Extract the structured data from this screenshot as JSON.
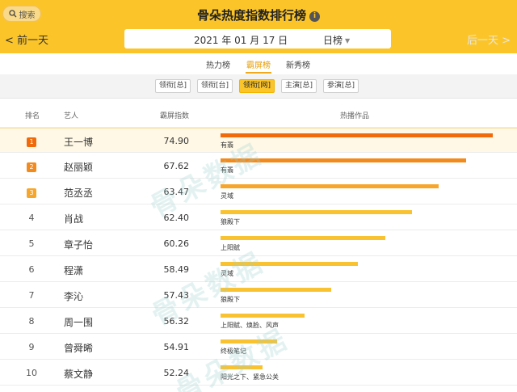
{
  "header": {
    "search_label": "搜索",
    "title": "骨朵热度指数排行榜",
    "info_icon": "i",
    "prev_label": "前一天",
    "next_label": "后一天",
    "date": "2021 年 01 月 17 日",
    "period": "日榜"
  },
  "tabs": [
    {
      "label": "热力榜",
      "active": false
    },
    {
      "label": "霸屏榜",
      "active": true
    },
    {
      "label": "新秀榜",
      "active": false
    }
  ],
  "subtabs": [
    {
      "label": "领衔[总]",
      "active": false
    },
    {
      "label": "领衔[台]",
      "active": false
    },
    {
      "label": "领衔[网]",
      "active": true
    },
    {
      "label": "主演[总]",
      "active": false
    },
    {
      "label": "参演[总]",
      "active": false
    }
  ],
  "table": {
    "headers": {
      "rank": "排名",
      "artist": "艺人",
      "index": "霸屏指数",
      "works": "热播作品"
    },
    "rows": [
      {
        "rank": "1",
        "name": "王一博",
        "score": "74.90",
        "works": "有翡",
        "bar": 0.91
      },
      {
        "rank": "2",
        "name": "赵丽颖",
        "score": "67.62",
        "works": "有翡",
        "bar": 0.82
      },
      {
        "rank": "3",
        "name": "范丞丞",
        "score": "63.47",
        "works": "灵域",
        "bar": 0.73
      },
      {
        "rank": "4",
        "name": "肖战",
        "score": "62.40",
        "works": "狼殿下",
        "bar": 0.64
      },
      {
        "rank": "5",
        "name": "章子怡",
        "score": "60.26",
        "works": "上阳赋",
        "bar": 0.55
      },
      {
        "rank": "6",
        "name": "程潇",
        "score": "58.49",
        "works": "灵域",
        "bar": 0.46
      },
      {
        "rank": "7",
        "name": "李沁",
        "score": "57.43",
        "works": "狼殿下",
        "bar": 0.37
      },
      {
        "rank": "8",
        "name": "周一围",
        "score": "56.32",
        "works": "上阳赋、焕脸、风声",
        "bar": 0.28
      },
      {
        "rank": "9",
        "name": "曾舜晞",
        "score": "54.91",
        "works": "终极笔记",
        "bar": 0.19
      },
      {
        "rank": "10",
        "name": "蔡文静",
        "score": "52.24",
        "works": "阳光之下、紧急公关",
        "bar": 0.14
      }
    ]
  },
  "watermark": "骨朵数据",
  "colors": {
    "header_bg": "#fbc52a",
    "rank_badge_1": "#f06a0c",
    "rank_badge_2": "#f38a1c",
    "rank_badge_3": "#f7a62a",
    "bar_1": "#f06a0c",
    "bar_2": "#f38a1c",
    "bar_3": "#f7a62a",
    "bar_default": "#f9c230"
  }
}
